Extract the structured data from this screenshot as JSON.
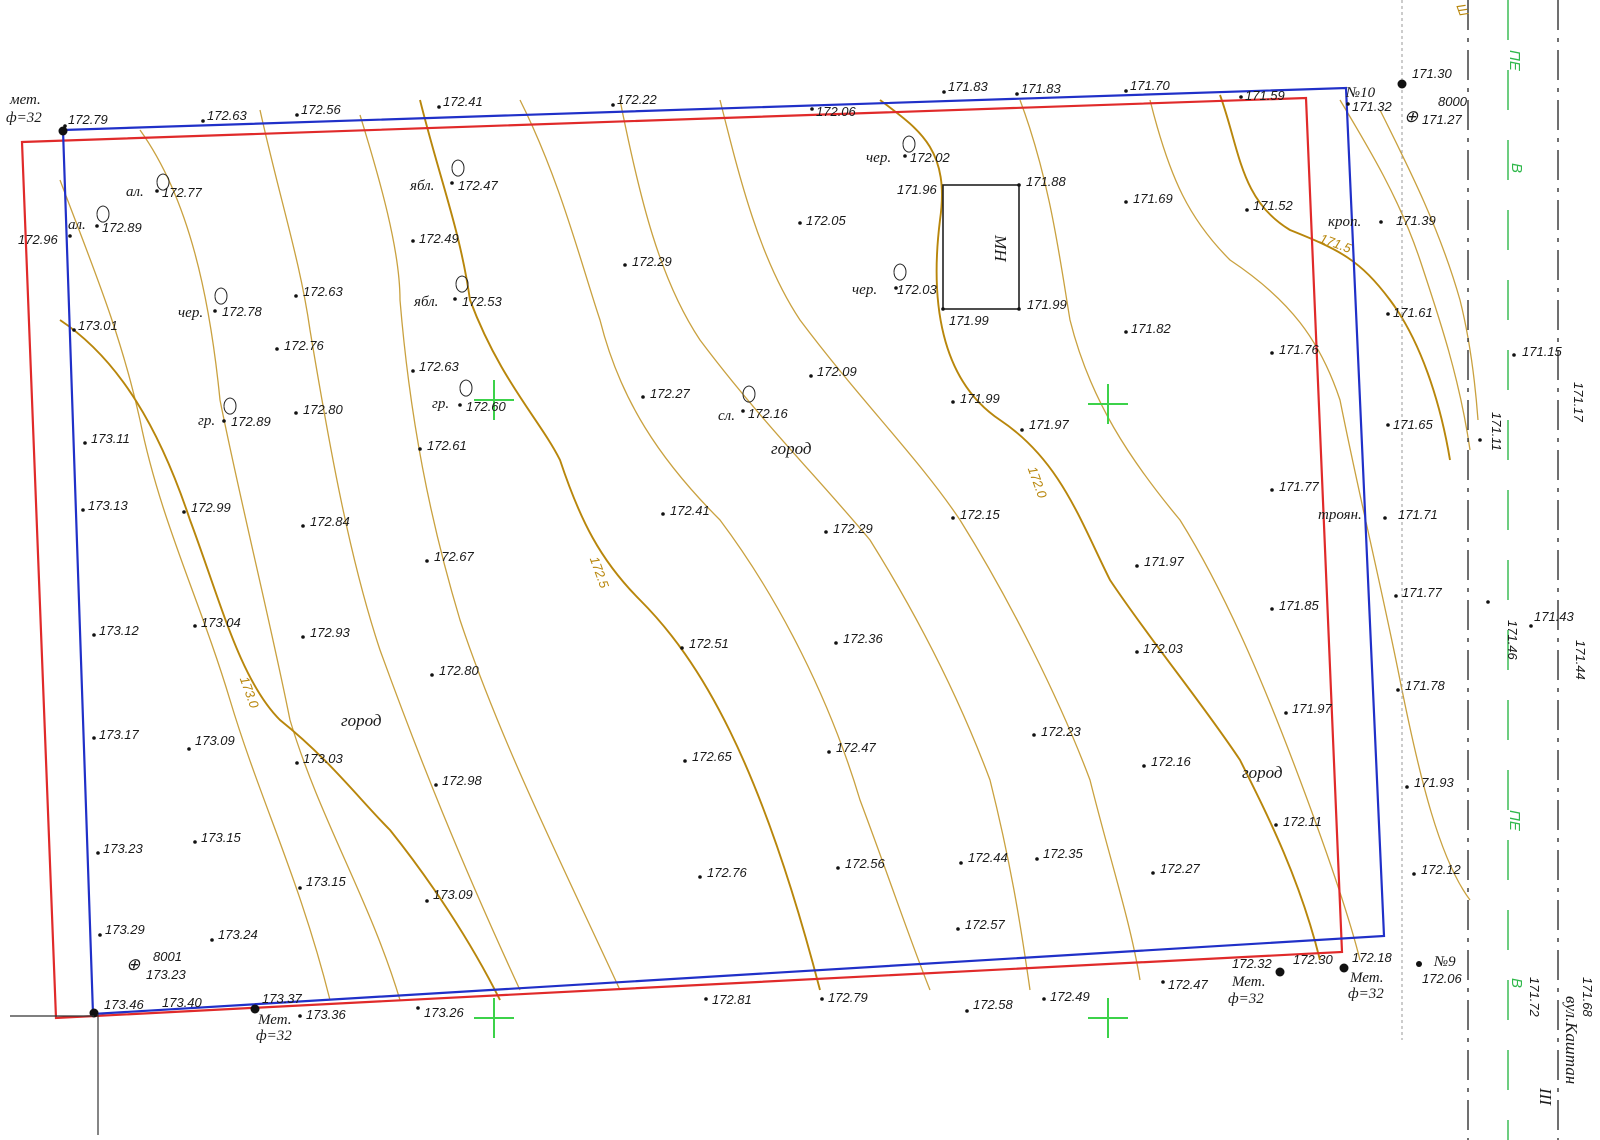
{
  "colors": {
    "boundary_red": "#e02a2a",
    "boundary_blue": "#2030c8",
    "contour": "#c9a13f",
    "contour_major": "#b8860b",
    "street_green": "#2fb84a",
    "cross_green": "#3cd24a"
  },
  "contour_labels": [
    "173.0",
    "172.5",
    "172.0",
    "171.5"
  ],
  "building": {
    "label": "МН"
  },
  "land_use": {
    "city": "город"
  },
  "pipes": {
    "met_text": "мет.",
    "met_cap": "Мет.",
    "diam": "ф=32"
  },
  "wells": {
    "no10": "№10",
    "no9": "№9",
    "w8000": "8000",
    "w8001": "8001"
  },
  "trees": {
    "al": "ал.",
    "cher": "чер.",
    "yabl": "ябл.",
    "gr": "гр.",
    "sl": "сл.",
    "krop": "кроп.",
    "troyan": "троян."
  },
  "street": {
    "name": "вул.Каштан",
    "roman": "III",
    "pe": "ПЕ",
    "v": "В",
    "sh": "Ш"
  },
  "elevations": {
    "e17279": "172.79",
    "e17263": "172.63",
    "e17256": "172.56",
    "e17241": "172.41",
    "e17222": "172.22",
    "e17206": "172.06",
    "e17183a": "171.83",
    "e17183b": "171.83",
    "e17170": "171.70",
    "e17159": "171.59",
    "e17132": "171.32",
    "e17130": "171.30",
    "e17127": "171.27",
    "e17277": "172.77",
    "e17289": "172.89",
    "e17296": "172.96",
    "e17247": "172.47",
    "e17202": "172.02",
    "e17196": "171.96",
    "e17188": "171.88",
    "e17169": "171.69",
    "e17152": "171.52",
    "e17139": "171.39",
    "e17249": "172.49",
    "e17229a": "172.29",
    "e17205": "172.05",
    "e17253": "172.53",
    "e17203a": "172.03",
    "e17199a": "171.99",
    "e17199b": "171.99",
    "e17182": "171.82",
    "e17161": "171.61",
    "e17178": "172.78",
    "e17263b": "172.63",
    "e17301": "173.01",
    "e17276": "172.76",
    "e17263c": "172.63",
    "e17209": "172.09",
    "e17176": "171.76",
    "e17115": "171.15",
    "e17117": "171.17",
    "e17289b": "172.89",
    "e17280": "172.80",
    "e17260": "172.60",
    "e17227": "172.27",
    "e17216": "172.16",
    "e17199c": "171.99",
    "e17197a": "171.97",
    "e17165": "171.65",
    "e17111": "171.11",
    "e17311": "173.11",
    "e17261": "172.61",
    "e17313": "173.13",
    "e17299": "172.99",
    "e17284": "172.84",
    "e17241b": "172.41",
    "e17229b": "172.29",
    "e17215": "172.15",
    "e17177a": "171.77",
    "e17171": "171.71",
    "e17267": "172.67",
    "e17197b": "171.97",
    "e17177b": "171.77",
    "e17312": "173.12",
    "e17304": "173.04",
    "e17293": "172.93",
    "e17280b": "172.80",
    "e17251": "172.51",
    "e17236": "172.36",
    "e17203b": "172.03",
    "e17185": "171.85",
    "e17146": "171.46",
    "e17143": "171.43",
    "e17144": "171.44",
    "e17317": "173.17",
    "e17309": "173.09",
    "e17303": "173.03",
    "e17298": "172.98",
    "e17265": "172.65",
    "e17247b": "172.47",
    "e17223": "172.23",
    "e17216b": "172.16",
    "e17197c": "171.97",
    "e17178b": "171.78",
    "e17323": "173.23",
    "e17315": "173.15",
    "e17315b": "173.15",
    "e17309b": "173.09",
    "e17276b": "172.76",
    "e17256b": "172.56",
    "e17244": "172.44",
    "e17235": "172.35",
    "e17227b": "172.27",
    "e17211": "172.11",
    "e17193": "171.93",
    "e17212": "172.12",
    "e17329": "173.29",
    "e17324": "173.24",
    "e17257": "172.57",
    "e17232": "172.32",
    "e17230": "172.30",
    "e17218": "172.18",
    "e17206b": "172.06",
    "e17323b": "173.23",
    "e17346": "173.46",
    "e17340": "173.40",
    "e17337": "173.37",
    "e17336": "173.36",
    "e17326": "173.26",
    "e17281": "172.81",
    "e17279b": "172.79",
    "e17258": "172.58",
    "e17249b": "172.49",
    "e17247c": "172.47",
    "e17172": "171.72",
    "e17168": "171.68"
  }
}
